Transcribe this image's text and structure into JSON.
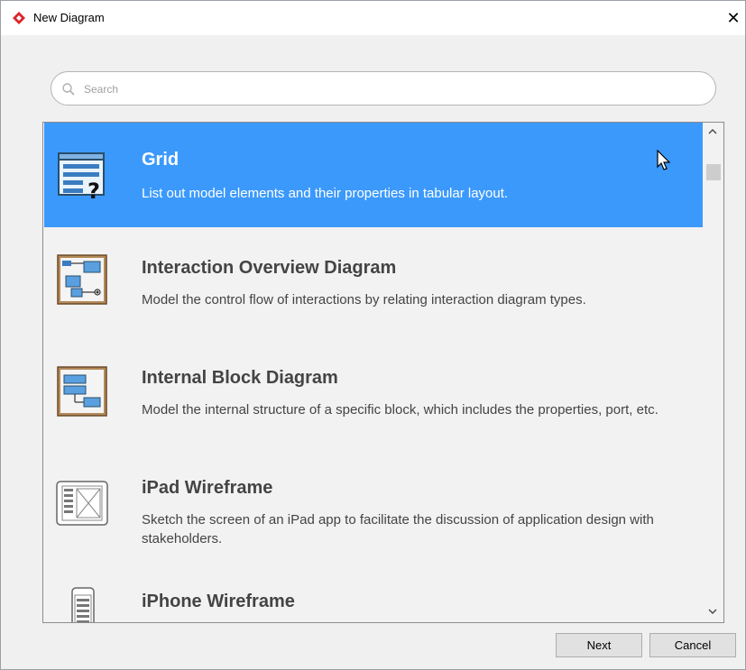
{
  "window": {
    "title": "New Diagram",
    "close_glyph": "✕"
  },
  "search": {
    "placeholder": "Search",
    "value": ""
  },
  "list": {
    "items": [
      {
        "title": "Grid",
        "description": "List out model elements and their properties in tabular layout.",
        "icon": "grid-diagram-icon",
        "selected": true
      },
      {
        "title": "Interaction Overview Diagram",
        "description": "Model the control flow of interactions by relating interaction diagram types.",
        "icon": "interaction-overview-diagram-icon",
        "selected": false
      },
      {
        "title": "Internal Block Diagram",
        "description": "Model the internal structure of a specific block, which includes the properties, port, etc.",
        "icon": "internal-block-diagram-icon",
        "selected": false
      },
      {
        "title": "iPad Wireframe",
        "description": "Sketch the screen of an iPad app to facilitate the discussion of application design with stakeholders.",
        "icon": "ipad-wireframe-icon",
        "selected": false
      },
      {
        "title": "iPhone Wireframe",
        "description": "",
        "icon": "iphone-wireframe-icon",
        "selected": false
      }
    ]
  },
  "buttons": {
    "next_label": "Next",
    "cancel_label": "Cancel"
  },
  "colors": {
    "selection": "#3b99fc",
    "brand": "#d9272e"
  }
}
